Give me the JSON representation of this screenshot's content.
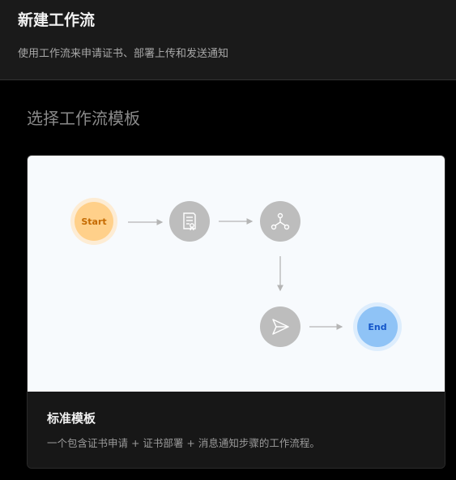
{
  "header": {
    "title": "新建工作流",
    "subtitle": "使用工作流来申请证书、部署上传和发送通知"
  },
  "section": {
    "title": "选择工作流模板"
  },
  "template_card": {
    "name": "标准模板",
    "description": "一个包含证书申请 + 证书部署 + 消息通知步骤的工作流程。",
    "flow": {
      "start_label": "Start",
      "end_label": "End",
      "nodes": [
        "start",
        "certificate-apply-icon",
        "deploy-icon",
        "notify-icon",
        "end"
      ]
    }
  },
  "colors": {
    "page_bg": "#000000",
    "header_bg": "#1a1a1a",
    "card_preview_bg": "#f7fafd",
    "start_fill": "#ffd08a",
    "start_text": "#c56a00",
    "end_fill": "#8fc3f6",
    "end_text": "#1456c9",
    "step_fill": "#bdbdbd"
  }
}
